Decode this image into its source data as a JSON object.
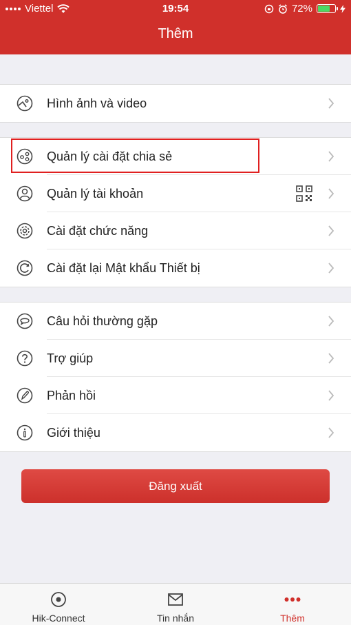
{
  "status_bar": {
    "carrier": "Viettel",
    "time": "19:54",
    "battery": "72%",
    "battery_level": 0.72
  },
  "header": {
    "title": "Thêm"
  },
  "menu": {
    "gallery": "Hình ảnh và video",
    "share_settings": "Quản lý cài đặt chia sẻ",
    "account": "Quản lý tài khoản",
    "functions": "Cài đặt chức năng",
    "reset_password": "Cài đặt lại Mật khẩu Thiết bị",
    "faq": "Câu hỏi thường gặp",
    "help": "Trợ giúp",
    "feedback": "Phản hồi",
    "about": "Giới thiệu"
  },
  "logout_label": "Đăng xuất",
  "tabs": [
    {
      "label": "Hik-Connect",
      "icon": "target-icon"
    },
    {
      "label": "Tin nhắn",
      "icon": "envelope-icon"
    },
    {
      "label": "Thêm",
      "icon": "more-dots-icon",
      "active": true
    }
  ],
  "colors": {
    "accent": "#d0302b",
    "highlight_box": "#e02020",
    "battery_fill": "#4cd964"
  }
}
